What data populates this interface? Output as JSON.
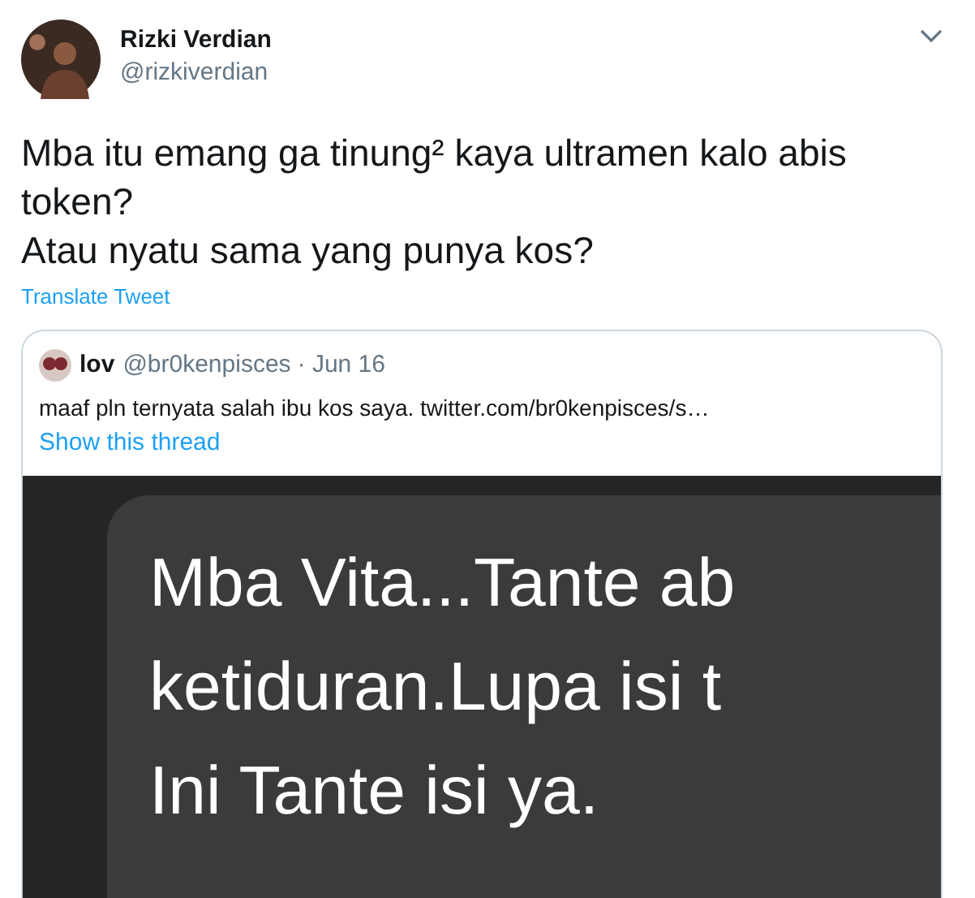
{
  "tweet": {
    "name": "Rizki Verdian",
    "handle": "@rizkiverdian",
    "text_lines": [
      "Mba itu emang ga tinung² kaya ultramen kalo abis token?",
      "Atau nyatu sama yang punya kos?"
    ],
    "translate_link": "Translate Tweet"
  },
  "quoted_tweet": {
    "name": "lov",
    "handle": "@br0kenpisces",
    "date": "· Jun 16",
    "text": "maaf pln ternyata salah ibu kos saya.  twitter.com/br0kenpisces/s…",
    "show_thread": "Show this thread",
    "image_lines": [
      "Mba Vita...Tante ab",
      "ketiduran.Lupa isi t",
      "Ini Tante isi ya."
    ]
  }
}
